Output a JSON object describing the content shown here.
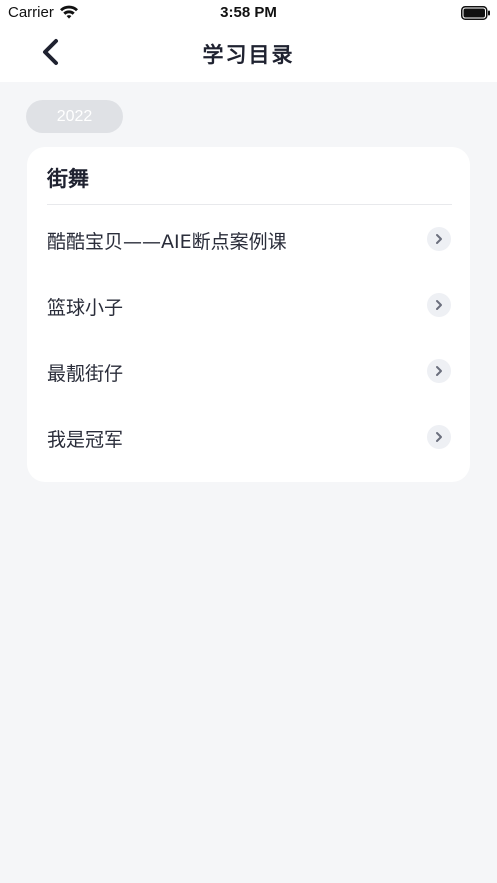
{
  "status_bar": {
    "carrier": "Carrier",
    "time": "3:58 PM"
  },
  "nav": {
    "title": "学习目录"
  },
  "year_badge": "2022",
  "section": {
    "title": "街舞",
    "items": [
      {
        "label": "酷酷宝贝——AIE断点案例课"
      },
      {
        "label": "篮球小子"
      },
      {
        "label": "最靓街仔"
      },
      {
        "label": "我是冠军"
      }
    ]
  },
  "colors": {
    "page_background": "#f5f6f8",
    "card_background": "#ffffff",
    "title_text": "#1f2230",
    "badge_background": "#dfe1e5",
    "chevron_background": "#eef0f4"
  },
  "icons": {
    "back": "chevron-left-icon",
    "row_chevron": "chevron-right-icon",
    "wifi": "wifi-icon",
    "battery": "battery-icon"
  }
}
